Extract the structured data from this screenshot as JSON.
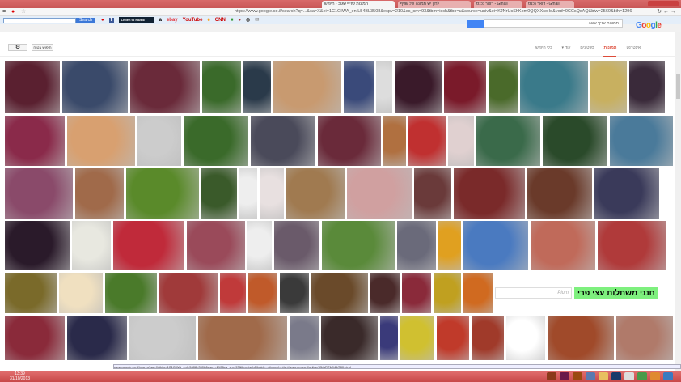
{
  "browser": {
    "tabs": [
      {
        "label": "תמונות שזיף שגוב - חיפוש",
        "active": true
      },
      {
        "label": "לחץ יש תמונה של שזיף",
        "active": false
      },
      {
        "label": "דואר נכנס - Gmail",
        "active": false
      },
      {
        "label": "דואר נכנס - Gmail",
        "active": false
      }
    ],
    "url": "https://www.google.co.il/search?q=...&sa=X&ei=1C1GIWA_enIL54BL3508&espv=210&es_sm=93&tbm=isch&tbo=u&source=univ&ei=KJNrUsShKom0QQXXsoIIo&ved=0CCsQsAQ&biw=2560&bih=1296"
  },
  "toolbar": {
    "search_placeholder": "",
    "search_label": "Search",
    "listen": "Listen to music",
    "sites": [
      "ebay",
      "YouTube",
      "CNN"
    ]
  },
  "google": {
    "logo": "Google",
    "search_value": "תמונות שזיף שגוב",
    "tabs": [
      "אינטרנט",
      "תמונות",
      "סרטונים",
      "עוד ▾",
      "כלי חיפוש"
    ],
    "active_tab": "תמונות",
    "safe_search": "חיפוש בטוח",
    "settings_icon": "gear-icon"
  },
  "promo": {
    "input_placeholder": "Plum",
    "banner": "חנני משתלות עצי פרי"
  },
  "status_url": "www.google.co.il/imgres?sa=X&biw=1C1GIWA_enIL5488L3508&espv=210&es_sm=93&tbm=isch&tbnid=...&imgurl=http://www.nrg.co.il/online/55/ART1/946/380.html",
  "taskbar": {
    "time": "13:39",
    "date": "31/10/2013"
  },
  "colors": {
    "accent": "#dd4b39",
    "banner": "#7ef07e",
    "taskbar": "#c84848"
  }
}
